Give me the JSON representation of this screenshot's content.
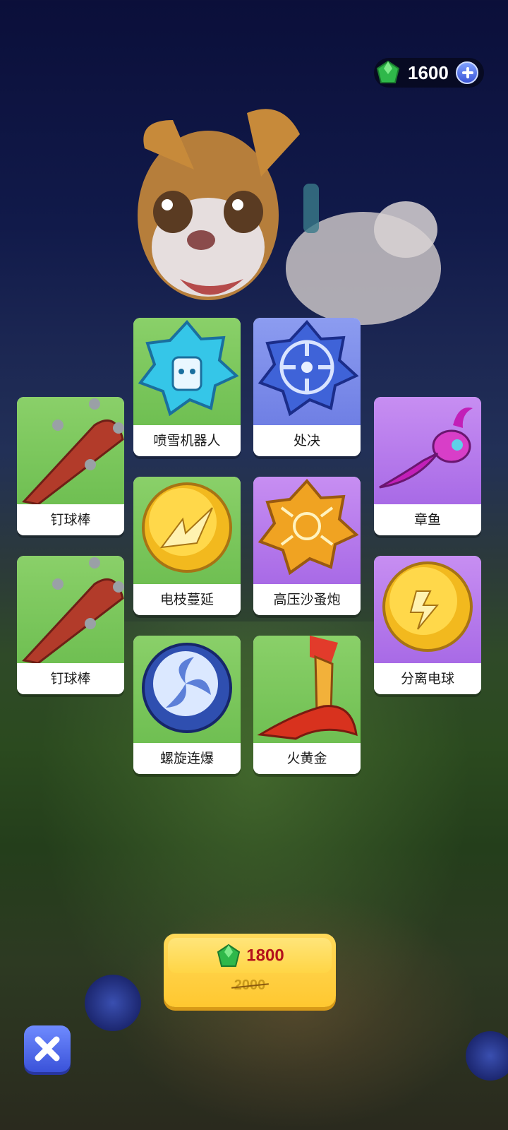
{
  "currency": {
    "amount": "1600",
    "icon": "gem-icon",
    "add_icon": "plus-icon"
  },
  "cards": [
    {
      "label": "喷雪机器人",
      "icon": "snow-robot-icon",
      "theme": "green"
    },
    {
      "label": "处决",
      "icon": "target-icon",
      "theme": "blue"
    },
    {
      "label": "钉球棒",
      "icon": "spiked-club-icon",
      "theme": "green"
    },
    {
      "label": "章鱼",
      "icon": "octopus-icon",
      "theme": "purple"
    },
    {
      "label": "电枝蔓延",
      "icon": "lightning-orb-icon",
      "theme": "green"
    },
    {
      "label": "高压沙蚤炮",
      "icon": "flea-cannon-icon",
      "theme": "purple"
    },
    {
      "label": "钉球棒",
      "icon": "spiked-club-icon",
      "theme": "green"
    },
    {
      "label": "分离电球",
      "icon": "split-orb-icon",
      "theme": "purple"
    },
    {
      "label": "螺旋连爆",
      "icon": "spiral-orb-icon",
      "theme": "green"
    },
    {
      "label": "火黄金",
      "icon": "fire-sword-icon",
      "theme": "green"
    }
  ],
  "buy": {
    "price": "1800",
    "original_price": "2000",
    "icon": "gem-icon"
  },
  "close": {
    "icon": "close-icon"
  },
  "colors": {
    "price": "#b3111c",
    "button": "#ffc830",
    "close": "#4a63e6"
  }
}
